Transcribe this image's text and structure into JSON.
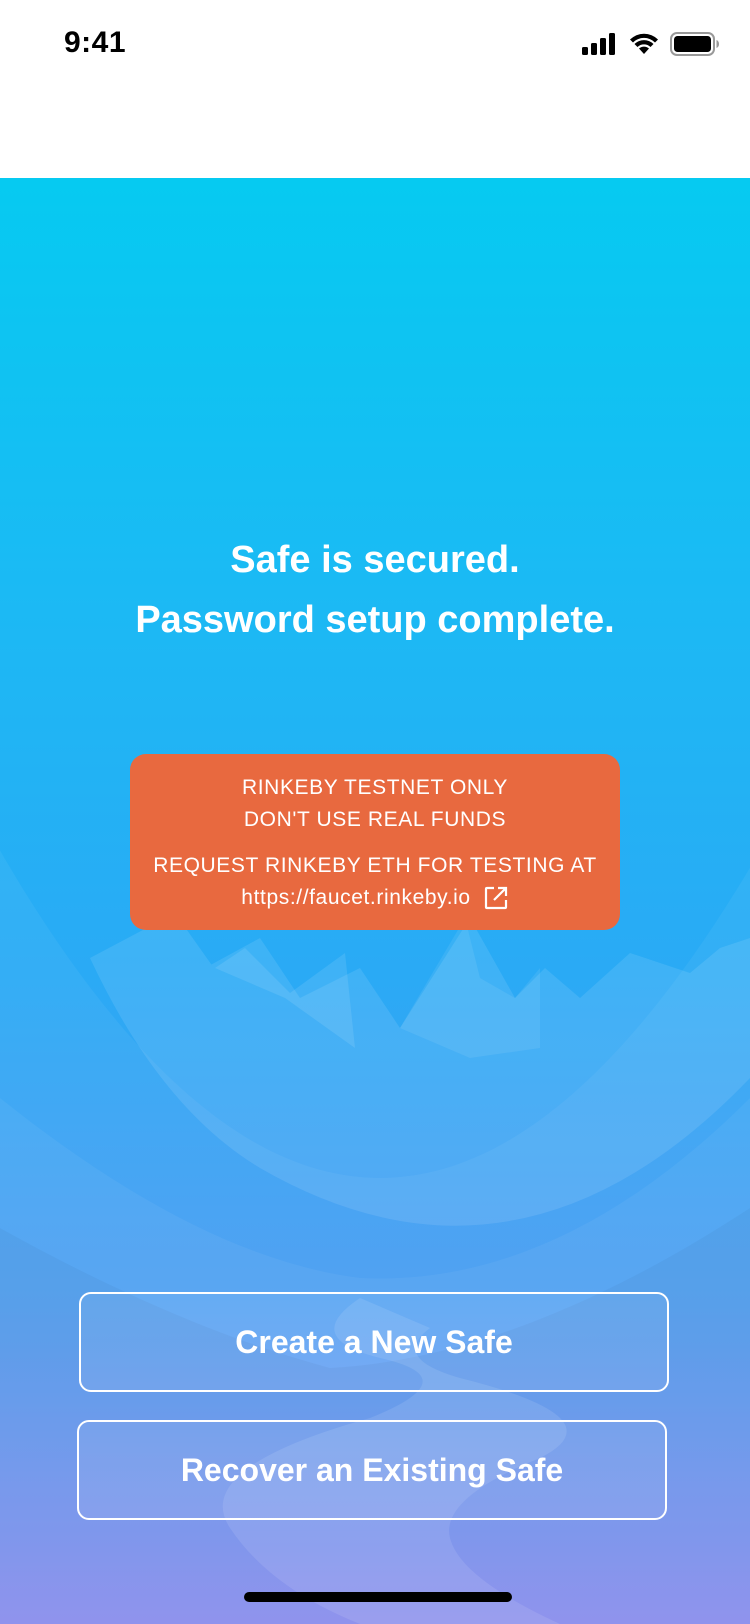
{
  "status_bar": {
    "time": "9:41",
    "icons": [
      "signal-icon",
      "wifi-icon",
      "battery-icon"
    ]
  },
  "headline": {
    "line1": "Safe is secured.",
    "line2": "Password setup complete."
  },
  "testnet_banner": {
    "line1": "RINKEBY TESTNET ONLY",
    "line2": "DON'T USE REAL FUNDS",
    "line3": "REQUEST RINKEBY ETH FOR TESTING AT",
    "link": "https://faucet.rinkeby.io",
    "link_icon": "external-link-icon",
    "color": "#e8693f"
  },
  "actions": {
    "create_label": "Create a New Safe",
    "recover_label": "Recover an Existing Safe"
  },
  "colors": {
    "gradient_top": "#06caf1",
    "gradient_bottom": "#8a8ef5"
  }
}
